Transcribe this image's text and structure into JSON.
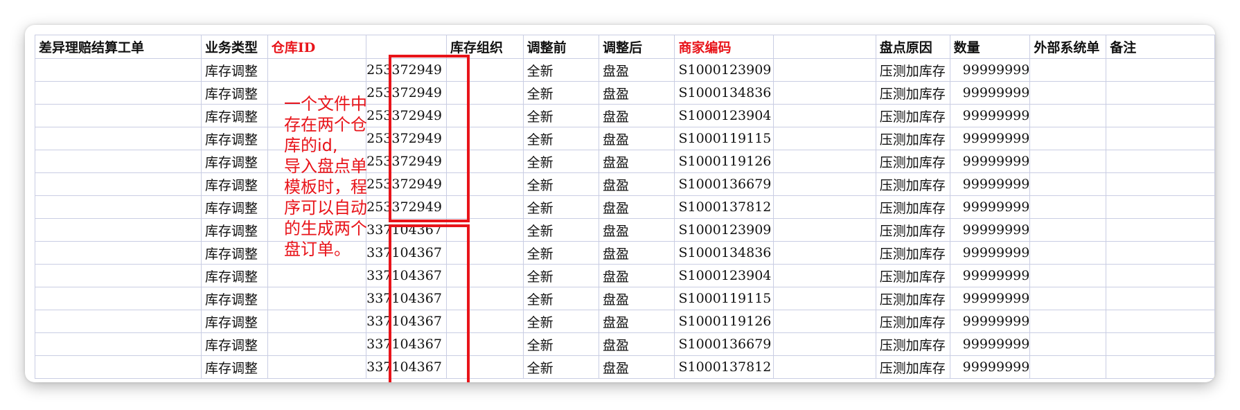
{
  "sheet": {
    "columns": [
      "差异理赔结算工单",
      "业务类型",
      "仓库ID",
      "",
      "库存组织",
      "调整前",
      "调整后",
      "商家编码",
      "",
      "盘点原因",
      "数量",
      "外部系统单",
      "备注"
    ],
    "red_columns": [
      2,
      7
    ],
    "rows": [
      [
        "",
        "库存调整",
        "",
        "253372949",
        "",
        "全新",
        "盘盈",
        "S1000123909",
        "",
        "压测加库存",
        "99999999",
        "",
        ""
      ],
      [
        "",
        "库存调整",
        "",
        "253372949",
        "",
        "全新",
        "盘盈",
        "S1000134836",
        "",
        "压测加库存",
        "99999999",
        "",
        ""
      ],
      [
        "",
        "库存调整",
        "",
        "253372949",
        "",
        "全新",
        "盘盈",
        "S1000123904",
        "",
        "压测加库存",
        "99999999",
        "",
        ""
      ],
      [
        "",
        "库存调整",
        "",
        "253372949",
        "",
        "全新",
        "盘盈",
        "S1000119115",
        "",
        "压测加库存",
        "99999999",
        "",
        ""
      ],
      [
        "",
        "库存调整",
        "",
        "253372949",
        "",
        "全新",
        "盘盈",
        "S1000119126",
        "",
        "压测加库存",
        "99999999",
        "",
        ""
      ],
      [
        "",
        "库存调整",
        "",
        "253372949",
        "",
        "全新",
        "盘盈",
        "S1000136679",
        "",
        "压测加库存",
        "99999999",
        "",
        ""
      ],
      [
        "",
        "库存调整",
        "",
        "253372949",
        "",
        "全新",
        "盘盈",
        "S1000137812",
        "",
        "压测加库存",
        "99999999",
        "",
        ""
      ],
      [
        "",
        "库存调整",
        "",
        "337104367",
        "",
        "全新",
        "盘盈",
        "S1000123909",
        "",
        "压测加库存",
        "99999999",
        "",
        ""
      ],
      [
        "",
        "库存调整",
        "",
        "337104367",
        "",
        "全新",
        "盘盈",
        "S1000134836",
        "",
        "压测加库存",
        "99999999",
        "",
        ""
      ],
      [
        "",
        "库存调整",
        "",
        "337104367",
        "",
        "全新",
        "盘盈",
        "S1000123904",
        "",
        "压测加库存",
        "99999999",
        "",
        ""
      ],
      [
        "",
        "库存调整",
        "",
        "337104367",
        "",
        "全新",
        "盘盈",
        "S1000119115",
        "",
        "压测加库存",
        "99999999",
        "",
        ""
      ],
      [
        "",
        "库存调整",
        "",
        "337104367",
        "",
        "全新",
        "盘盈",
        "S1000119126",
        "",
        "压测加库存",
        "99999999",
        "",
        ""
      ],
      [
        "",
        "库存调整",
        "",
        "337104367",
        "",
        "全新",
        "盘盈",
        "S1000136679",
        "",
        "压测加库存",
        "99999999",
        "",
        ""
      ],
      [
        "",
        "库存调整",
        "",
        "337104367",
        "",
        "全新",
        "盘盈",
        "S1000137812",
        "",
        "压测加库存",
        "99999999",
        "",
        ""
      ]
    ]
  },
  "annotation": {
    "text": "一个文件中存在两个仓库的id,\n导入盘点单模板时，程序可以自动的生成两个盘订单。"
  },
  "colors": {
    "accent_red": "#e8141a",
    "grid_line": "#c9cde3"
  }
}
